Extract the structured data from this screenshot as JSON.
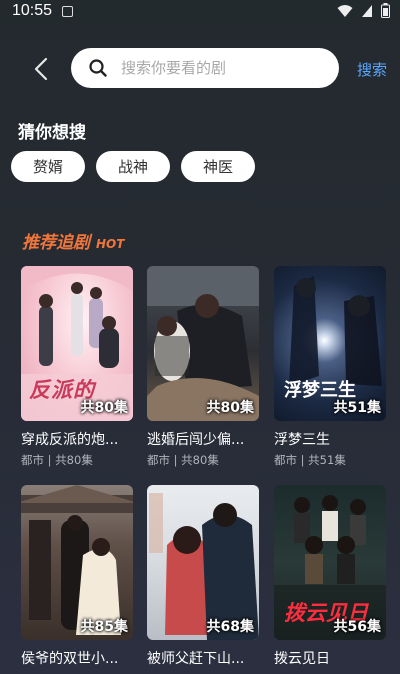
{
  "status_bar": {
    "time": "10:55"
  },
  "search": {
    "placeholder": "搜索你要看的剧",
    "button_label": "搜索"
  },
  "guess": {
    "title": "猜你想搜",
    "chips": [
      "赘婿",
      "战神",
      "神医"
    ]
  },
  "recommend": {
    "title": "推荐追剧",
    "subtitle": "HOT",
    "items": [
      {
        "title": "穿成反派的炮...",
        "meta": "都市 | 共80集",
        "episodes": "共80集",
        "poster_text": "反派的"
      },
      {
        "title": "逃婚后闯少偏...",
        "meta": "都市 | 共80集",
        "episodes": "共80集"
      },
      {
        "title": "浮梦三生",
        "meta": "都市 | 共51集",
        "episodes": "共51集",
        "poster_text": "浮梦三生"
      },
      {
        "title": "侯爷的双世小...",
        "meta": "",
        "episodes": "共85集"
      },
      {
        "title": "被师父赶下山...",
        "meta": "",
        "episodes": "共68集"
      },
      {
        "title": "拨云见日",
        "meta": "",
        "episodes": "共56集",
        "poster_text": "拨云见日"
      }
    ]
  },
  "colors": {
    "accent": "#f0763c",
    "link": "#5aa6ff"
  }
}
